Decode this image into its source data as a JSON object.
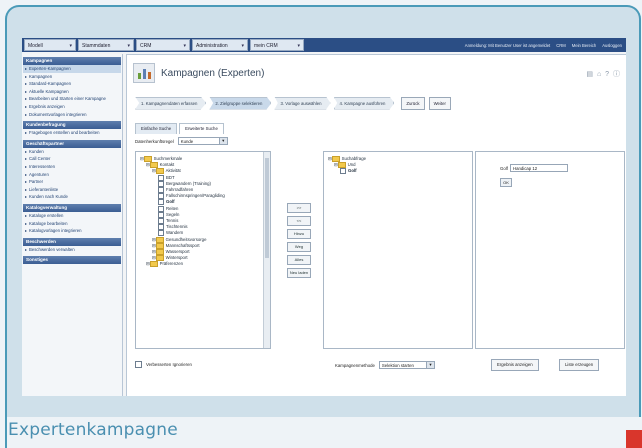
{
  "caption": "Expertenkampagne",
  "topnav": {
    "tabs": [
      "Modell",
      "Stammdaten",
      "CRM",
      "Administration",
      "mein CRM"
    ],
    "right": [
      "Anmeldung: Mit Benutzer User ist angemeldet",
      "CRM",
      "Mein Bereich",
      "Ausloggen"
    ]
  },
  "sidebar": [
    {
      "head": "Kampagnen",
      "items": [
        "Experten-Kampagnen",
        "Kampagnen",
        "Standard-Kampagnen",
        "Aktuelle Kampagnen",
        "Bearbeiten und Starten einer Kampagne",
        "Ergebnis anzeigen",
        "Dokumentvorlagen integrieren"
      ]
    },
    {
      "head": "Kundenbefragung",
      "items": [
        "Fragebogen erstellen und bearbeiten"
      ]
    },
    {
      "head": "Geschäftspartner",
      "items": [
        "Kunden",
        "Call Center",
        "Interessenten",
        "Agenturen",
        "Partner",
        "Lieferantenliste",
        "Kunden nach Kunde"
      ]
    },
    {
      "head": "Katalogverwaltung",
      "items": [
        "Kataloge erstellen",
        "Kataloge bearbeiten",
        "Katalogvorlagen integrieren"
      ]
    },
    {
      "head": "Beschwerden",
      "items": [
        "Beschwerden verwalten"
      ]
    },
    {
      "head": "Sonstiges",
      "items": []
    }
  ],
  "content": {
    "title": "Kampagnen (Experten)",
    "toolbar_icons": "▤ ⌂ ? ⓘ",
    "wizard_steps": [
      "1. Kampagnendaten erfassen",
      "2. Zielgruppe selektieren",
      "3. Vorlage auswählen",
      "4. Kampagne ausführen"
    ],
    "active_step": 1,
    "wizard_buttons": [
      "Zurück",
      "Weiter"
    ],
    "subtabs": [
      "Einfache Suche",
      "Erweiterte Suche"
    ],
    "filter_label": "Datenherkunftsregel",
    "filter_value": "Kunde",
    "tree": [
      {
        "label": "Suchmerkmale",
        "level": 0,
        "type": "folder"
      },
      {
        "label": "Kontakt",
        "level": 1,
        "type": "folder"
      },
      {
        "label": "Aktivität",
        "level": 2,
        "type": "folder"
      },
      {
        "label": "BDT",
        "level": 3,
        "type": "leaf"
      },
      {
        "label": "Bergwandern (Training)",
        "level": 3,
        "type": "leaf"
      },
      {
        "label": "Fahrradfahren",
        "level": 3,
        "type": "leaf"
      },
      {
        "label": "Fallschirmspringen/Paragliding",
        "level": 3,
        "type": "leaf"
      },
      {
        "label": "Golf",
        "level": 3,
        "type": "leaf",
        "bold": true
      },
      {
        "label": "Reiten",
        "level": 3,
        "type": "leaf"
      },
      {
        "label": "Segeln",
        "level": 3,
        "type": "leaf"
      },
      {
        "label": "Tennis",
        "level": 3,
        "type": "leaf"
      },
      {
        "label": "Tischtennis",
        "level": 3,
        "type": "leaf"
      },
      {
        "label": "Wandern",
        "level": 3,
        "type": "leaf"
      },
      {
        "label": "Gesundheitsvorsorge",
        "level": 2,
        "type": "folder"
      },
      {
        "label": "Mannschaftssport",
        "level": 2,
        "type": "folder"
      },
      {
        "label": "Wassersport",
        "level": 2,
        "type": "folder"
      },
      {
        "label": "Wintersport",
        "level": 2,
        "type": "folder"
      },
      {
        "label": "Präferenzen",
        "level": 1,
        "type": "folder"
      }
    ],
    "mid_buttons": [
      ">>",
      "<<",
      "Hinzu",
      "Weg",
      "Alles",
      "Neu laden"
    ],
    "target_tree": [
      {
        "label": "Suchabfrage",
        "level": 0,
        "type": "folder"
      },
      {
        "label": "Und",
        "level": 1,
        "type": "folder"
      },
      {
        "label": "Golf",
        "level": 2,
        "type": "leaf",
        "bold": true
      }
    ],
    "prop_label": "Golf",
    "prop_value": "Handicap 12",
    "prop_button": "OK",
    "bottom": {
      "checkbox_label": "Verbesserten Ignorieren",
      "mode_label": "Kampagnenmethode",
      "mode_value": "Selektion starten",
      "buttons": [
        "Ergebnis anzeigen",
        "Liste erzeugen"
      ]
    }
  }
}
